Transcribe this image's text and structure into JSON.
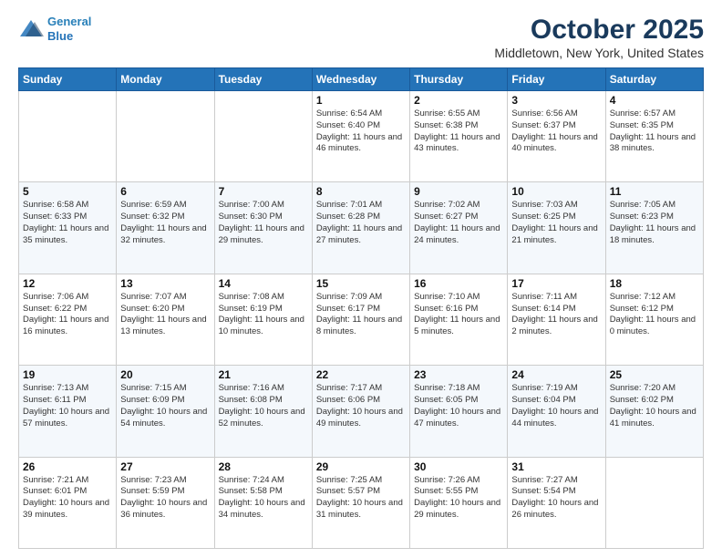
{
  "header": {
    "logo_line1": "General",
    "logo_line2": "Blue",
    "title": "October 2025",
    "subtitle": "Middletown, New York, United States"
  },
  "weekdays": [
    "Sunday",
    "Monday",
    "Tuesday",
    "Wednesday",
    "Thursday",
    "Friday",
    "Saturday"
  ],
  "weeks": [
    {
      "days": [
        {
          "num": "",
          "info": ""
        },
        {
          "num": "",
          "info": ""
        },
        {
          "num": "",
          "info": ""
        },
        {
          "num": "1",
          "info": "Sunrise: 6:54 AM\nSunset: 6:40 PM\nDaylight: 11 hours\nand 46 minutes."
        },
        {
          "num": "2",
          "info": "Sunrise: 6:55 AM\nSunset: 6:38 PM\nDaylight: 11 hours\nand 43 minutes."
        },
        {
          "num": "3",
          "info": "Sunrise: 6:56 AM\nSunset: 6:37 PM\nDaylight: 11 hours\nand 40 minutes."
        },
        {
          "num": "4",
          "info": "Sunrise: 6:57 AM\nSunset: 6:35 PM\nDaylight: 11 hours\nand 38 minutes."
        }
      ]
    },
    {
      "days": [
        {
          "num": "5",
          "info": "Sunrise: 6:58 AM\nSunset: 6:33 PM\nDaylight: 11 hours\nand 35 minutes."
        },
        {
          "num": "6",
          "info": "Sunrise: 6:59 AM\nSunset: 6:32 PM\nDaylight: 11 hours\nand 32 minutes."
        },
        {
          "num": "7",
          "info": "Sunrise: 7:00 AM\nSunset: 6:30 PM\nDaylight: 11 hours\nand 29 minutes."
        },
        {
          "num": "8",
          "info": "Sunrise: 7:01 AM\nSunset: 6:28 PM\nDaylight: 11 hours\nand 27 minutes."
        },
        {
          "num": "9",
          "info": "Sunrise: 7:02 AM\nSunset: 6:27 PM\nDaylight: 11 hours\nand 24 minutes."
        },
        {
          "num": "10",
          "info": "Sunrise: 7:03 AM\nSunset: 6:25 PM\nDaylight: 11 hours\nand 21 minutes."
        },
        {
          "num": "11",
          "info": "Sunrise: 7:05 AM\nSunset: 6:23 PM\nDaylight: 11 hours\nand 18 minutes."
        }
      ]
    },
    {
      "days": [
        {
          "num": "12",
          "info": "Sunrise: 7:06 AM\nSunset: 6:22 PM\nDaylight: 11 hours\nand 16 minutes."
        },
        {
          "num": "13",
          "info": "Sunrise: 7:07 AM\nSunset: 6:20 PM\nDaylight: 11 hours\nand 13 minutes."
        },
        {
          "num": "14",
          "info": "Sunrise: 7:08 AM\nSunset: 6:19 PM\nDaylight: 11 hours\nand 10 minutes."
        },
        {
          "num": "15",
          "info": "Sunrise: 7:09 AM\nSunset: 6:17 PM\nDaylight: 11 hours\nand 8 minutes."
        },
        {
          "num": "16",
          "info": "Sunrise: 7:10 AM\nSunset: 6:16 PM\nDaylight: 11 hours\nand 5 minutes."
        },
        {
          "num": "17",
          "info": "Sunrise: 7:11 AM\nSunset: 6:14 PM\nDaylight: 11 hours\nand 2 minutes."
        },
        {
          "num": "18",
          "info": "Sunrise: 7:12 AM\nSunset: 6:12 PM\nDaylight: 11 hours\nand 0 minutes."
        }
      ]
    },
    {
      "days": [
        {
          "num": "19",
          "info": "Sunrise: 7:13 AM\nSunset: 6:11 PM\nDaylight: 10 hours\nand 57 minutes."
        },
        {
          "num": "20",
          "info": "Sunrise: 7:15 AM\nSunset: 6:09 PM\nDaylight: 10 hours\nand 54 minutes."
        },
        {
          "num": "21",
          "info": "Sunrise: 7:16 AM\nSunset: 6:08 PM\nDaylight: 10 hours\nand 52 minutes."
        },
        {
          "num": "22",
          "info": "Sunrise: 7:17 AM\nSunset: 6:06 PM\nDaylight: 10 hours\nand 49 minutes."
        },
        {
          "num": "23",
          "info": "Sunrise: 7:18 AM\nSunset: 6:05 PM\nDaylight: 10 hours\nand 47 minutes."
        },
        {
          "num": "24",
          "info": "Sunrise: 7:19 AM\nSunset: 6:04 PM\nDaylight: 10 hours\nand 44 minutes."
        },
        {
          "num": "25",
          "info": "Sunrise: 7:20 AM\nSunset: 6:02 PM\nDaylight: 10 hours\nand 41 minutes."
        }
      ]
    },
    {
      "days": [
        {
          "num": "26",
          "info": "Sunrise: 7:21 AM\nSunset: 6:01 PM\nDaylight: 10 hours\nand 39 minutes."
        },
        {
          "num": "27",
          "info": "Sunrise: 7:23 AM\nSunset: 5:59 PM\nDaylight: 10 hours\nand 36 minutes."
        },
        {
          "num": "28",
          "info": "Sunrise: 7:24 AM\nSunset: 5:58 PM\nDaylight: 10 hours\nand 34 minutes."
        },
        {
          "num": "29",
          "info": "Sunrise: 7:25 AM\nSunset: 5:57 PM\nDaylight: 10 hours\nand 31 minutes."
        },
        {
          "num": "30",
          "info": "Sunrise: 7:26 AM\nSunset: 5:55 PM\nDaylight: 10 hours\nand 29 minutes."
        },
        {
          "num": "31",
          "info": "Sunrise: 7:27 AM\nSunset: 5:54 PM\nDaylight: 10 hours\nand 26 minutes."
        },
        {
          "num": "",
          "info": ""
        }
      ]
    }
  ]
}
